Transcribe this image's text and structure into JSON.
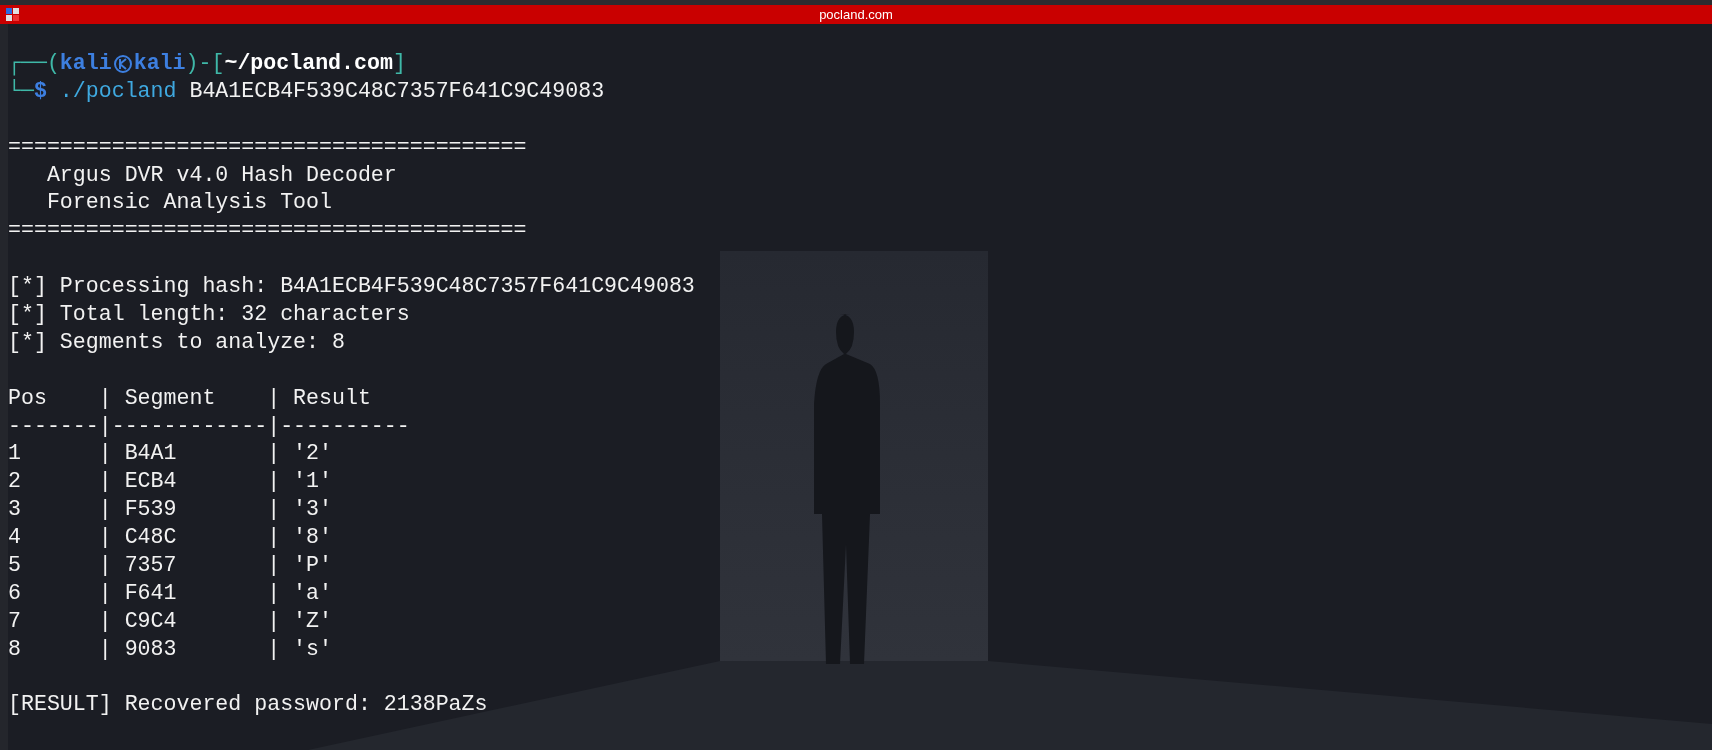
{
  "window": {
    "title": "pocland.com"
  },
  "prompt": {
    "line1": [
      {
        "kind": "frame",
        "text": "┌──("
      },
      {
        "kind": "user",
        "text": "kali"
      },
      {
        "kind": "at_icon"
      },
      {
        "kind": "user",
        "text": "kali"
      },
      {
        "kind": "frame",
        "text": ")-["
      },
      {
        "kind": "path",
        "text": "~/pocland.com"
      },
      {
        "kind": "frame",
        "text": "]"
      }
    ],
    "line2": [
      {
        "kind": "frame",
        "text": "└─"
      },
      {
        "kind": "user",
        "text": "$"
      },
      {
        "kind": "command",
        "text": " ./pocland"
      },
      {
        "kind": "plain",
        "text": " B4A1ECB4F539C48C7357F641C9C49083"
      }
    ]
  },
  "output": [
    {
      "kind": "blank"
    },
    {
      "kind": "text",
      "text": "========================================"
    },
    {
      "kind": "text",
      "text": "   Argus DVR v4.0 Hash Decoder"
    },
    {
      "kind": "text",
      "text": "   Forensic Analysis Tool"
    },
    {
      "kind": "text",
      "text": "========================================"
    },
    {
      "kind": "blank"
    },
    {
      "kind": "text",
      "text": "[*] Processing hash: B4A1ECB4F539C48C7357F641C9C49083"
    },
    {
      "kind": "text",
      "text": "[*] Total length: 32 characters"
    },
    {
      "kind": "text",
      "text": "[*] Segments to analyze: 8"
    },
    {
      "kind": "blank"
    },
    {
      "kind": "text",
      "text": "Pos    | Segment    | Result"
    },
    {
      "kind": "text",
      "text": "-------|------------|----------"
    },
    {
      "kind": "text",
      "text": "1      | B4A1       | '2'"
    },
    {
      "kind": "text",
      "text": "2      | ECB4       | '1'"
    },
    {
      "kind": "text",
      "text": "3      | F539       | '3'"
    },
    {
      "kind": "text",
      "text": "4      | C48C       | '8'"
    },
    {
      "kind": "text",
      "text": "5      | 7357       | 'P'"
    },
    {
      "kind": "text",
      "text": "6      | F641       | 'a'"
    },
    {
      "kind": "text",
      "text": "7      | C9C4       | 'Z'"
    },
    {
      "kind": "text",
      "text": "8      | 9083       | 's'"
    },
    {
      "kind": "blank"
    },
    {
      "kind": "text",
      "text": "[RESULT] Recovered password: 2138PaZs"
    }
  ]
}
